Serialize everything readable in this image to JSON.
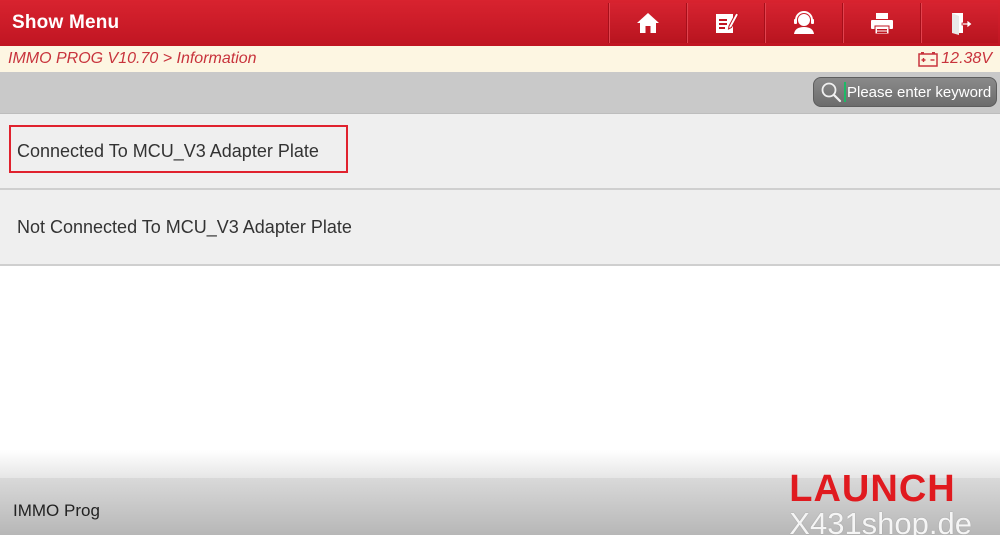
{
  "header": {
    "title": "Show Menu",
    "toolbar": [
      {
        "name": "home-button",
        "icon": "home-icon"
      },
      {
        "name": "report-button",
        "icon": "edit-report-icon"
      },
      {
        "name": "remote-support-button",
        "icon": "support-agent-icon"
      },
      {
        "name": "print-button",
        "icon": "printer-icon"
      },
      {
        "name": "exit-button",
        "icon": "exit-door-icon"
      }
    ]
  },
  "breadcrumb": {
    "path": "IMMO PROG V10.70 > Information",
    "voltage": "12.38V"
  },
  "search": {
    "placeholder": "Please enter keyword",
    "value": ""
  },
  "list": {
    "items": [
      {
        "label": "Connected To MCU_V3 Adapter Plate",
        "selected": true
      },
      {
        "label": "Not Connected To MCU_V3 Adapter Plate",
        "selected": false
      }
    ]
  },
  "footer": {
    "label": "IMMO Prog"
  },
  "brand": {
    "name": "LAUNCH",
    "site": "X431shop.de"
  },
  "colors": {
    "header_red": "#c8192a",
    "breadcrumb_bg": "#fdf6e2",
    "breadcrumb_text": "#c8333c",
    "highlight": "#e0222e",
    "brand_red": "#e01a1f"
  }
}
